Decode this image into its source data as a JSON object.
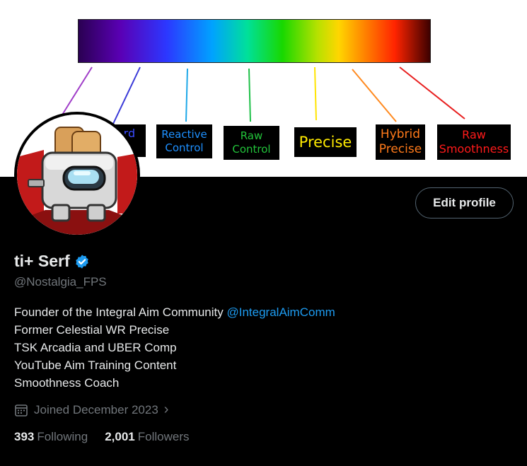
{
  "banner": {
    "labels": [
      {
        "line1": "Reactive",
        "line2": "Control",
        "color": "#1e90ff"
      },
      {
        "line1": "Raw",
        "line2": "Control",
        "color": "#22c33a"
      },
      {
        "line1": "Precise",
        "line2": "",
        "color": "#ffea00"
      },
      {
        "line1": "Hybrid",
        "line2": "Precise",
        "color": "#ff7a1a"
      },
      {
        "line1": "Raw",
        "line2": "Smoothness",
        "color": "#ff1a1a"
      }
    ],
    "partial_label": {
      "line1": "ord",
      "line2": "e",
      "color": "#3a4bff"
    }
  },
  "profile": {
    "display_name": "ti+ Serf",
    "handle": "@Nostalgia_FPS",
    "edit_button": "Edit profile",
    "bio_line1_text": "Founder of the Integral Aim Community ",
    "bio_line1_link": "@IntegralAimComm",
    "bio_line2": "Former Celestial WR Precise",
    "bio_line3": "TSK Arcadia and UBER Comp",
    "bio_line4": "YouTube Aim Training Content",
    "bio_line5": "Smoothness Coach",
    "joined": "Joined December 2023",
    "following_count": "393",
    "following_label": "Following",
    "followers_count": "2,001",
    "followers_label": "Followers",
    "verified_color": "#1d9bf0"
  }
}
